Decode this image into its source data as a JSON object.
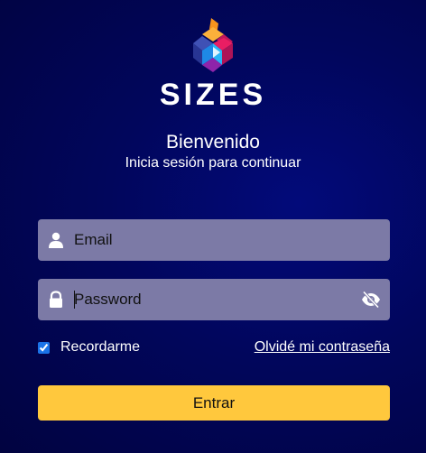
{
  "brand": {
    "name": "SIZES",
    "logo_icon": "sizes-cube-logo"
  },
  "header": {
    "title": "Bienvenido",
    "subtitle": "Inicia sesión para continuar"
  },
  "form": {
    "email": {
      "placeholder": "Email",
      "value": "",
      "icon": "user-icon"
    },
    "password": {
      "placeholder": "Password",
      "value": "",
      "icon": "lock-icon",
      "toggle_icon": "eye-slash-icon"
    },
    "remember": {
      "label": "Recordarme",
      "checked": true
    },
    "forgot_link": "Olvidé mi contraseña",
    "submit_label": "Entrar"
  },
  "colors": {
    "background": "#01065c",
    "field": "#7c7aa6",
    "button": "#ffc83d",
    "text": "#ffffff"
  }
}
